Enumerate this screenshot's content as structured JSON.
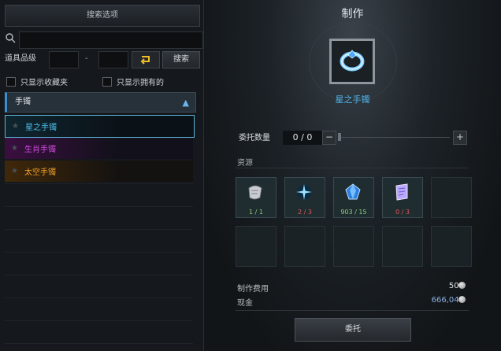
{
  "search_panel": {
    "title": "搜索选项",
    "search_placeholder": "",
    "grade_label": "道具品级",
    "grade_separator": "-",
    "search_button": "搜索",
    "filter_favorites": "只显示收藏夹",
    "filter_owned": "只显示拥有的",
    "category": "手镯",
    "results": [
      {
        "name": "星之手镯",
        "color": "#4fc3f0"
      },
      {
        "name": "生肖手镯",
        "color": "#d04ce0"
      },
      {
        "name": "太空手镯",
        "color": "#f0a028"
      }
    ]
  },
  "craft_panel": {
    "title": "制作",
    "item_name": "星之手镯",
    "quantity_label": "委托数量",
    "quantity_value": "0 / 0",
    "resources_label": "资源",
    "resources": [
      {
        "icon": "scroll-icon",
        "count": "1 / 1",
        "status": "ok"
      },
      {
        "icon": "sparkle-icon",
        "count": "2 / 3",
        "status": "bad"
      },
      {
        "icon": "crystal-icon",
        "count": "903 / 15",
        "status": "ok"
      },
      {
        "icon": "parchment-icon",
        "count": "0 / 3",
        "status": "bad"
      }
    ],
    "cost_label": "制作费用",
    "cost_value": "500",
    "cash_label": "现金",
    "cash_value": "666,045",
    "commit_button": "委托"
  }
}
